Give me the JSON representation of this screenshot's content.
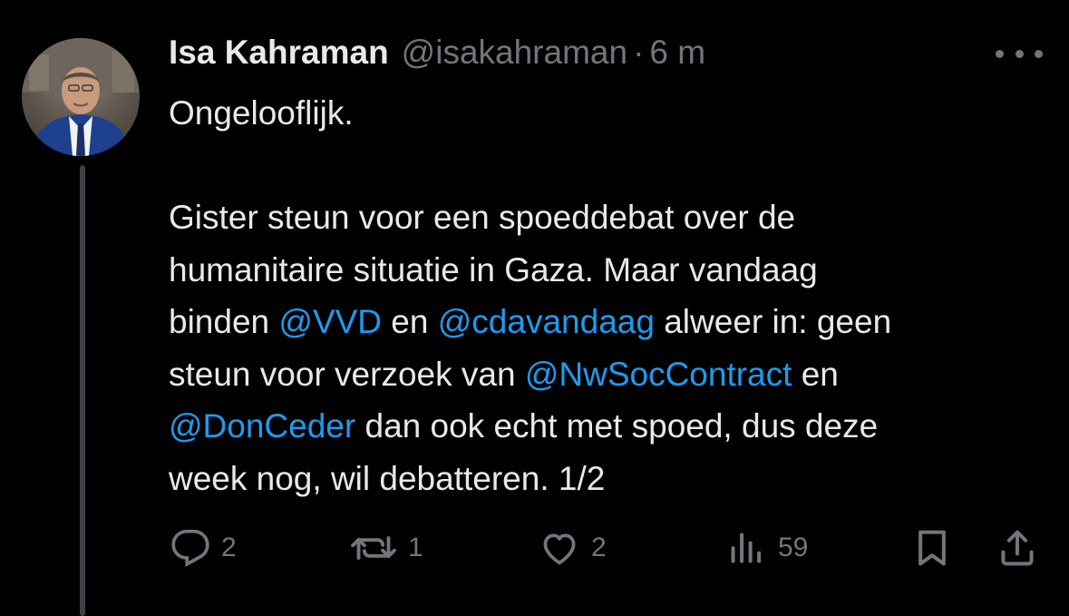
{
  "author": {
    "display_name": "Isa Kahraman",
    "handle": "@isakahraman",
    "separator": "·",
    "time": "6 m"
  },
  "tweet": {
    "lines": [
      [
        {
          "text": "Ongelooflijk."
        }
      ],
      [
        {
          "text": ""
        }
      ],
      [
        {
          "text": "Gister steun voor een spoeddebat over de"
        }
      ],
      [
        {
          "text": "humanitaire situatie in Gaza. Maar vandaag"
        }
      ],
      [
        {
          "text": "binden "
        },
        {
          "text": "@VVD",
          "mention": true
        },
        {
          "text": " en "
        },
        {
          "text": "@cdavandaag",
          "mention": true
        },
        {
          "text": " alweer in: geen"
        }
      ],
      [
        {
          "text": "steun voor verzoek van "
        },
        {
          "text": "@NwSocContract",
          "mention": true
        },
        {
          "text": " en"
        }
      ],
      [
        {
          "text": "@DonCeder",
          "mention": true
        },
        {
          "text": " dan ook echt met spoed, dus deze"
        }
      ],
      [
        {
          "text": "week nog, wil debatteren. 1/2"
        }
      ]
    ]
  },
  "actions": {
    "replies": "2",
    "reposts": "1",
    "likes": "2",
    "views": "59"
  },
  "icons": {
    "reply": "reply-icon",
    "repost": "repost-icon",
    "like": "like-icon",
    "views": "views-icon",
    "bookmark": "bookmark-icon",
    "share": "share-icon",
    "more": "more-icon"
  },
  "colors": {
    "background": "#000000",
    "text": "#e7e9ea",
    "secondary": "#71767b",
    "mention": "#1d9bf0",
    "thread_line": "#3e4144"
  }
}
